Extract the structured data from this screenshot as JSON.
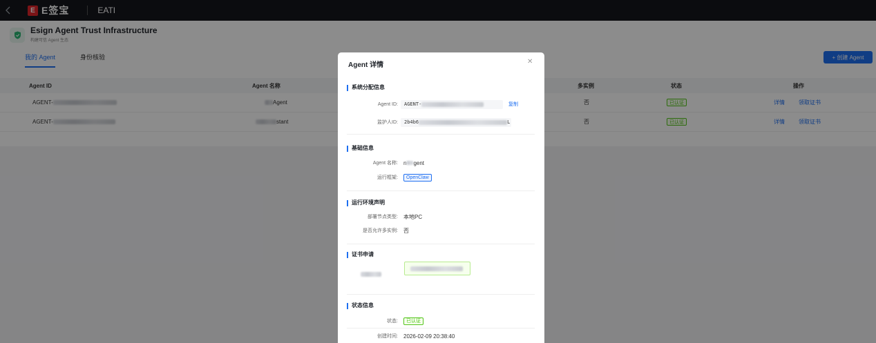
{
  "topbar": {
    "back_icon": "chevron-left-icon",
    "logo_badge": "E",
    "logo_text": "E签宝",
    "app_name": "EATI"
  },
  "header": {
    "title": "Esign Agent Trust Infrastructure",
    "subtitle": "构建可信 Agent 生态",
    "icon": "shield-check-icon"
  },
  "tabs": [
    {
      "label": "我的 Agent",
      "active": true
    },
    {
      "label": "身份核验",
      "active": false
    }
  ],
  "create_button": "+ 创建 Agent",
  "table": {
    "columns": [
      "Agent ID",
      "Agent 名称",
      "多实例",
      "状态",
      "操作"
    ],
    "rows": [
      {
        "agent_id_prefix": "AGENT-",
        "name_suffix": "Agent",
        "multi_instance": "否",
        "status": "已认证",
        "actions": [
          "详情",
          "领取证书"
        ]
      },
      {
        "agent_id_prefix": "AGENT-",
        "name_suffix": "stant",
        "multi_instance": "否",
        "status": "已认证",
        "actions": [
          "详情",
          "领取证书"
        ]
      }
    ]
  },
  "modal": {
    "title": "Agent 详情",
    "close_icon": "close-icon",
    "sections": {
      "system": {
        "title": "系统分配信息",
        "agent_id_label": "Agent ID:",
        "agent_id_value": "AGENT-",
        "copy_label": "复制",
        "guardian_label": "监护人ID:",
        "guardian_value_prefix": "2b4b6",
        "guardian_value_suffix": "L"
      },
      "basic": {
        "title": "基础信息",
        "name_label": "Agent 名称:",
        "name_prefix": "n",
        "name_suffix": "gent",
        "framework_label": "运行框架:",
        "framework_value": "OpenClaw"
      },
      "runtime": {
        "title": "运行环境声明",
        "node_label": "部署节点类型:",
        "node_value": "本地PC",
        "multi_label": "是否允许多实例:",
        "multi_value": "否"
      },
      "cert": {
        "title": "证书申请"
      },
      "status": {
        "title": "状态信息",
        "status_label": "状态:",
        "status_value": "已认证",
        "created_label": "创建时间:",
        "created_value": "2026-02-09 20:38:40"
      }
    }
  },
  "colors": {
    "primary": "#1e6ff0",
    "success": "#52c41a",
    "topbar": "#15171c",
    "brand_red": "#e0262b"
  }
}
